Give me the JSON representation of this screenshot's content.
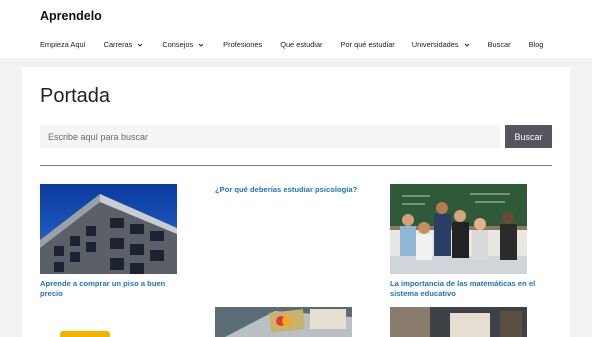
{
  "site": {
    "title": "Aprendelo"
  },
  "nav": {
    "items": [
      {
        "label": "Empieza Aquí",
        "dropdown": false
      },
      {
        "label": "Carreras",
        "dropdown": true
      },
      {
        "label": "Consejos",
        "dropdown": true
      },
      {
        "label": "Profesiones",
        "dropdown": false
      },
      {
        "label": "Que estudiar",
        "dropdown": false
      },
      {
        "label": "Por qué estudiar",
        "dropdown": false
      },
      {
        "label": "Universidades",
        "dropdown": true
      },
      {
        "label": "Buscar",
        "dropdown": false
      },
      {
        "label": "Blog",
        "dropdown": false
      }
    ]
  },
  "page": {
    "title": "Portada"
  },
  "search": {
    "placeholder": "Escribe aquí para buscar",
    "button_label": "Buscar"
  },
  "posts": [
    {
      "title": "Aprende a comprar un piso a buen precio",
      "image": "building-photo"
    },
    {
      "title": "¿Por qué deberías estudiar psicología?",
      "image": ""
    },
    {
      "title": "La importancia de las matemáticas en el sistema educativo",
      "image": "students-classroom-photo"
    },
    {
      "title": "",
      "image": "piggy-bank-photo"
    },
    {
      "title": "",
      "image": "credit-cards-photo"
    },
    {
      "title": "",
      "image": "person-laptop-photo"
    }
  ],
  "colors": {
    "link": "#1e73be",
    "button_bg": "#55555e",
    "page_bg": "#f1f2f3",
    "content_bg": "#ffffff"
  }
}
